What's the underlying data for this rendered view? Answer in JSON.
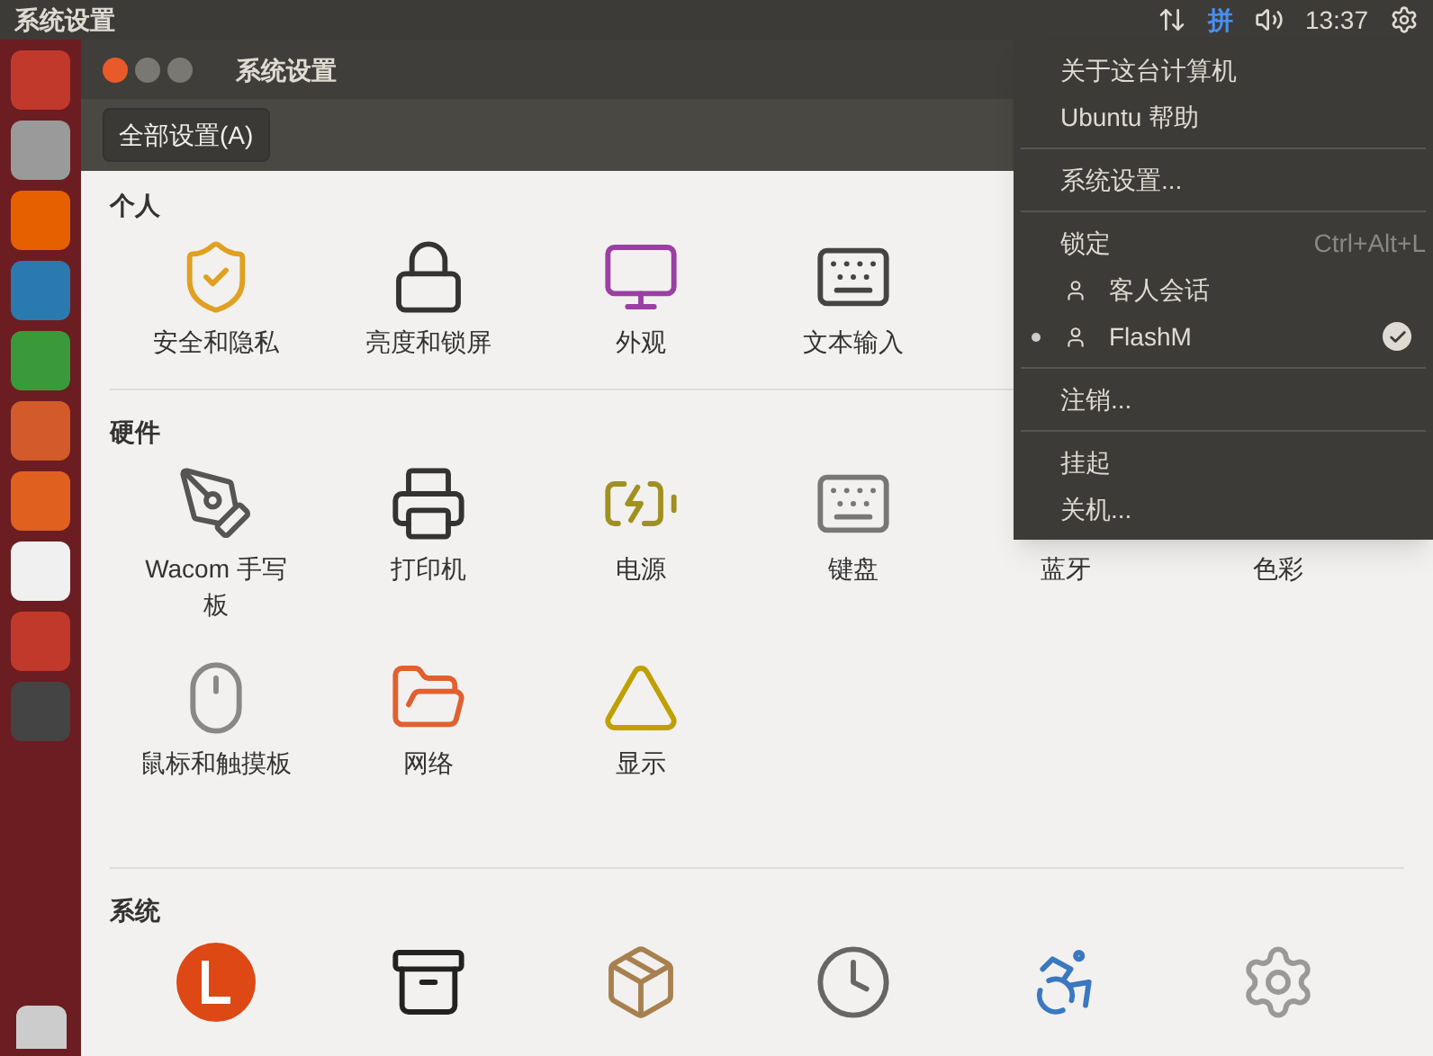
{
  "top_bar": {
    "title": "系统设置",
    "ime": "拼",
    "time": "13:37"
  },
  "window": {
    "title": "系统设置",
    "all_settings_button": "全部设置(A)"
  },
  "sections": [
    {
      "title": "个人",
      "items": [
        {
          "label": "安全和隐私"
        },
        {
          "label": "亮度和锁屏"
        },
        {
          "label": "外观"
        },
        {
          "label": "文本输入"
        }
      ]
    },
    {
      "title": "硬件",
      "items": [
        {
          "label": "Wacom 手写板"
        },
        {
          "label": "打印机"
        },
        {
          "label": "电源"
        },
        {
          "label": "键盘"
        },
        {
          "label": "蓝牙"
        },
        {
          "label": "色彩"
        },
        {
          "label": "鼠标和触摸板"
        },
        {
          "label": "网络"
        },
        {
          "label": "显示"
        }
      ]
    },
    {
      "title": "系统"
    }
  ],
  "menu": [
    {
      "kind": "item",
      "label": "关于这台计算机"
    },
    {
      "kind": "item",
      "label": "Ubuntu 帮助"
    },
    {
      "kind": "separator"
    },
    {
      "kind": "item",
      "label": "系统设置..."
    },
    {
      "kind": "separator"
    },
    {
      "kind": "shortcut",
      "label": "锁定",
      "shortcut": "Ctrl+Alt+L"
    },
    {
      "kind": "user",
      "label": "客人会话",
      "logged_in": false,
      "current": false
    },
    {
      "kind": "user",
      "label": "FlashM",
      "logged_in": true,
      "current": true
    },
    {
      "kind": "separator"
    },
    {
      "kind": "item",
      "label": "注销..."
    },
    {
      "kind": "separator"
    },
    {
      "kind": "item",
      "label": "挂起"
    },
    {
      "kind": "item",
      "label": "关机..."
    }
  ]
}
